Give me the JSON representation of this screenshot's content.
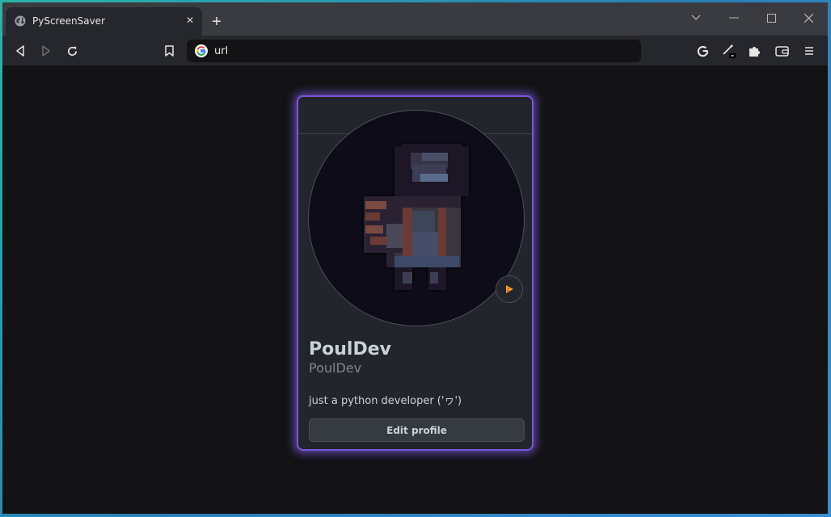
{
  "browser": {
    "tab_title": "PyScreenSaver",
    "tab_close": "×",
    "new_tab": "+",
    "url": "url"
  },
  "icons": {
    "tab_favicon": "globe-icon",
    "back": "back-icon",
    "forward": "forward-icon",
    "reload": "reload-icon",
    "bookmark": "bookmark-icon",
    "address_bar_logo": "google-icon",
    "google_extension": "google-icon",
    "pen_extension": "pen-icon",
    "extensions": "puzzle-icon",
    "wallet": "wallet-icon",
    "menu": "menu-icon",
    "tab_search": "chevron-down-icon",
    "minimize": "minimize-icon",
    "maximize": "maximize-icon",
    "close_window": "close-icon",
    "status": "status-emoji-icon"
  },
  "profile": {
    "display_name": "PoulDev",
    "username": "PoulDev",
    "bio": "just a python developer ('ヮ')",
    "edit_button": "Edit profile"
  },
  "colors": {
    "accent_glow": "#7b57d9",
    "card_bg": "#22262c",
    "page_bg": "#131316"
  }
}
